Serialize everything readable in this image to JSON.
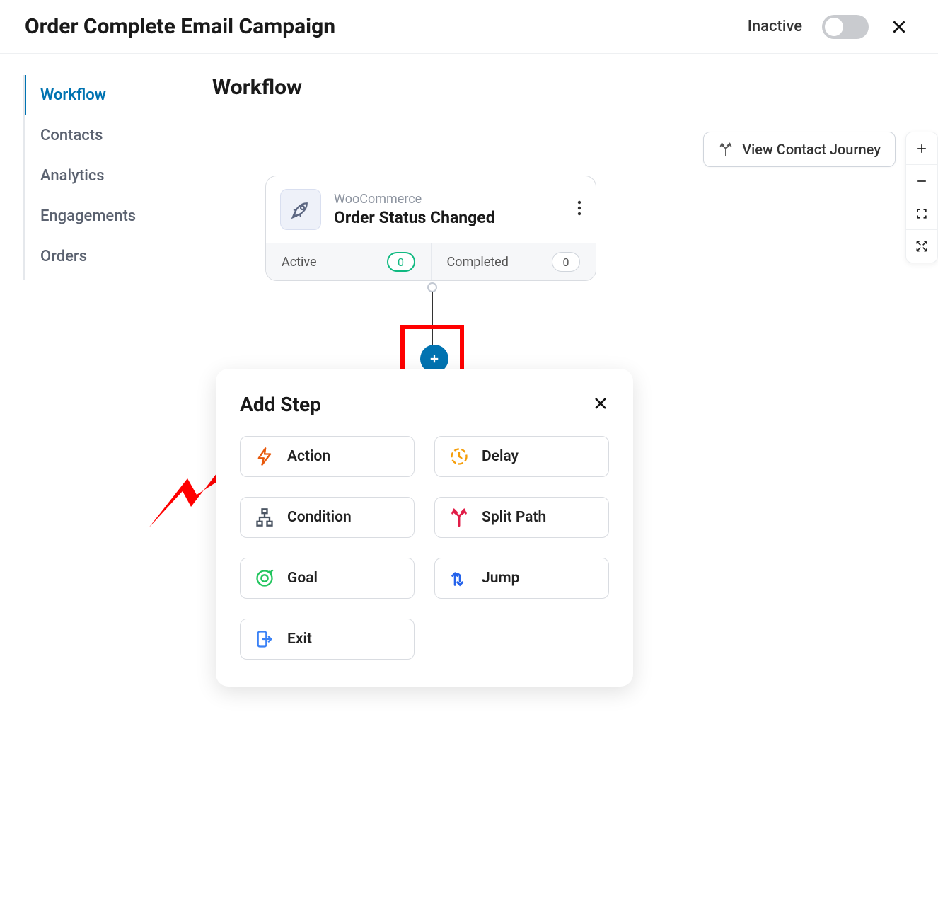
{
  "header": {
    "title": "Order Complete Email Campaign",
    "status_label": "Inactive"
  },
  "sidebar": {
    "items": [
      {
        "label": "Workflow",
        "active": true
      },
      {
        "label": "Contacts",
        "active": false
      },
      {
        "label": "Analytics",
        "active": false
      },
      {
        "label": "Engagements",
        "active": false
      },
      {
        "label": "Orders",
        "active": false
      }
    ]
  },
  "content": {
    "title": "Workflow",
    "view_journey_btn": "View Contact Journey"
  },
  "trigger": {
    "subtitle": "WooCommerce",
    "title": "Order Status Changed",
    "stats": {
      "active_label": "Active",
      "active_value": "0",
      "completed_label": "Completed",
      "completed_value": "0"
    }
  },
  "add_step": {
    "title": "Add Step",
    "options": [
      {
        "label": "Action",
        "icon": "bolt",
        "color": "#e8590c"
      },
      {
        "label": "Delay",
        "icon": "clock",
        "color": "#f59e0b"
      },
      {
        "label": "Condition",
        "icon": "tree",
        "color": "#4b5563"
      },
      {
        "label": "Split Path",
        "icon": "split",
        "color": "#e11d48"
      },
      {
        "label": "Goal",
        "icon": "target",
        "color": "#22c55e"
      },
      {
        "label": "Jump",
        "icon": "jump",
        "color": "#2563eb"
      },
      {
        "label": "Exit",
        "icon": "exit",
        "color": "#3b82f6"
      }
    ]
  }
}
